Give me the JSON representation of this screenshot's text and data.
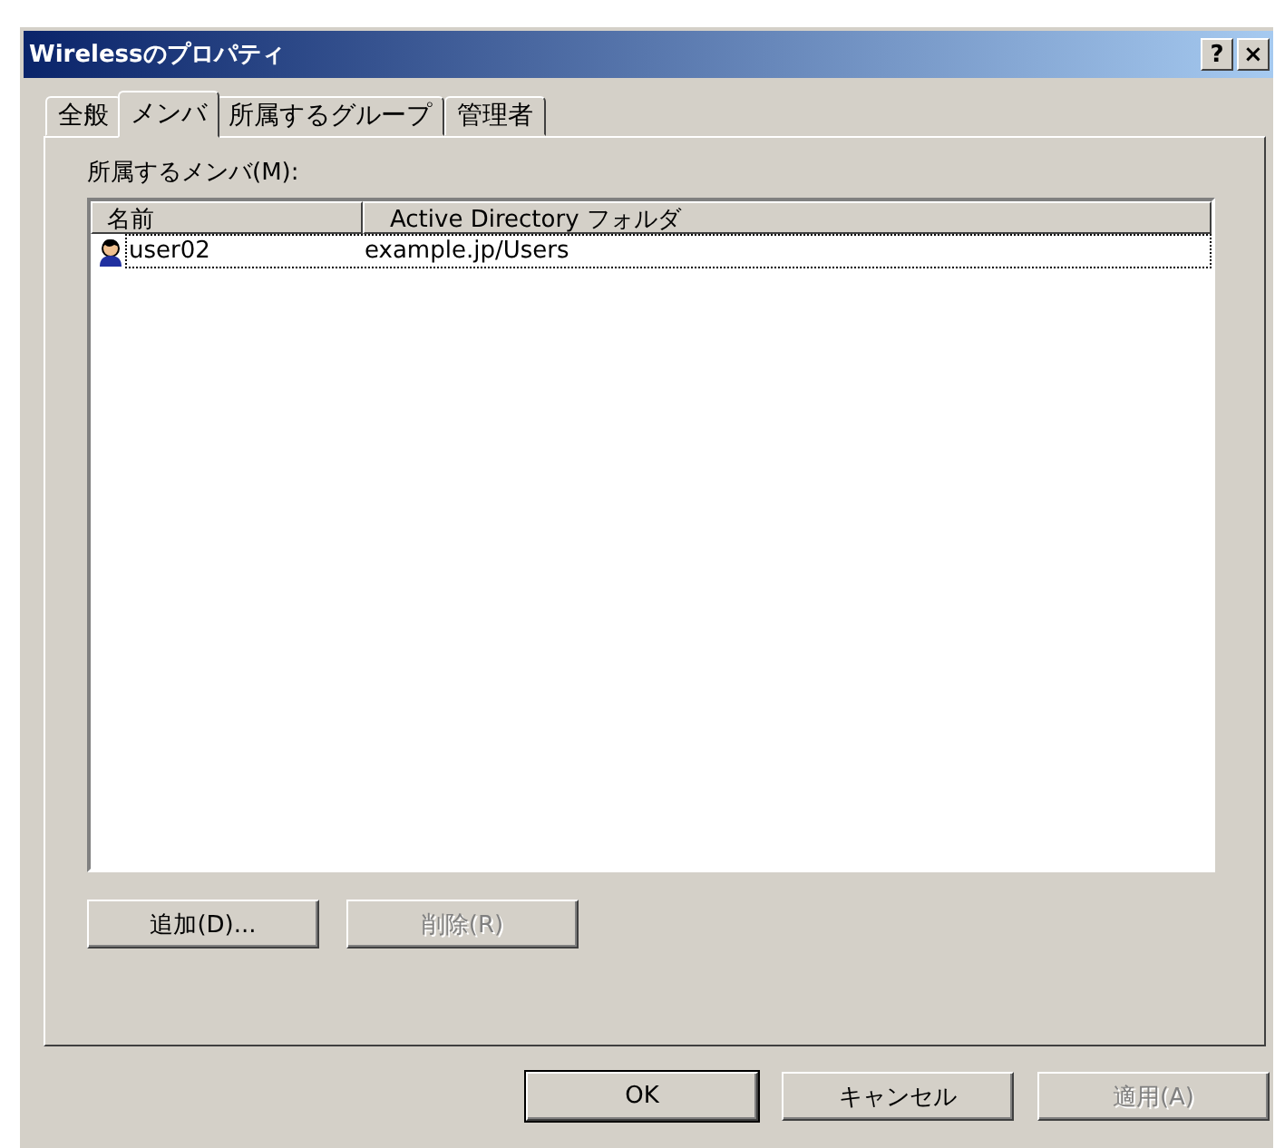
{
  "window": {
    "title": "Wirelessのプロパティ",
    "title_buttons": [
      "?",
      "×"
    ]
  },
  "tabs": [
    {
      "label": "全般",
      "selected": false
    },
    {
      "label": "メンバ",
      "selected": true
    },
    {
      "label": "所属するグループ",
      "selected": false
    },
    {
      "label": "管理者",
      "selected": false
    }
  ],
  "members": {
    "label": "所属するメンバ(M):",
    "columns": [
      "名前",
      "Active Directory フォルダ"
    ],
    "rows": [
      {
        "name": "user02",
        "folder": "example.jp/Users",
        "focused": true
      }
    ]
  },
  "list_buttons": [
    {
      "label": "追加(D)...",
      "disabled": false
    },
    {
      "label": "削除(R)",
      "disabled": true
    }
  ],
  "dialog_buttons": [
    {
      "label": "OK",
      "disabled": false,
      "default": true
    },
    {
      "label": "キャンセル",
      "disabled": false,
      "default": false
    },
    {
      "label": "適用(A)",
      "disabled": true,
      "default": false
    }
  ]
}
